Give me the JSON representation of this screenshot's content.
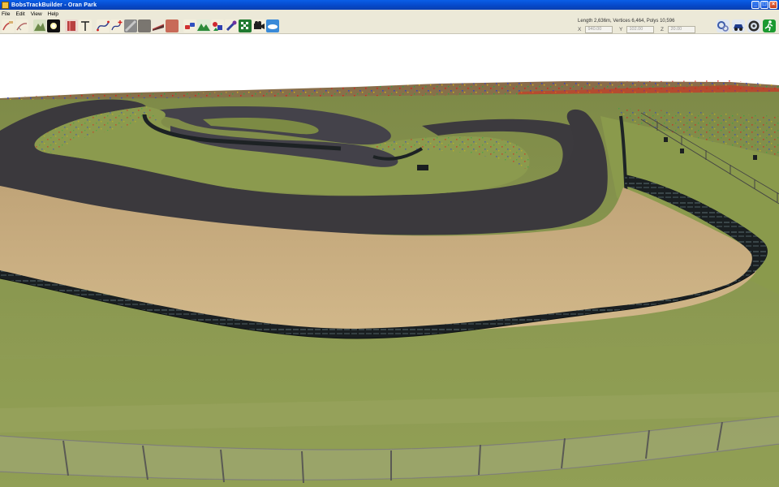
{
  "window": {
    "title": "BobsTrackBuilder - Oran Park",
    "buttons": {
      "minimize": "_",
      "maximize": "□",
      "close": "×"
    }
  },
  "menu": [
    "File",
    "Edit",
    "View",
    "Help"
  ],
  "toolbar": {
    "tool_icons": [
      "pencil-curve-icon",
      "select-curve-icon",
      "terrain-icon",
      "camera-flash-icon",
      "wall-red-icon",
      "fence-post-icon",
      "road-sign-icon",
      "spline-icon",
      "spline-add-icon",
      "object-icon",
      "texture-grey-icon",
      "road-slope-icon",
      "texture-red-icon",
      "object-cars-icon",
      "mountains-icon",
      "objects-palette-icon",
      "brush-icon",
      "checker-flag-icon",
      "video-camera-icon",
      "sky-icon"
    ],
    "stats": "Length 2,636m, Vertices 6,464, Polys 10,596",
    "coords": {
      "x_label": "X",
      "x_value": "940.00",
      "y_label": "Y",
      "y_value": "102.00",
      "z_label": "Z",
      "z_value": "20.00"
    },
    "right_icons": [
      "settings-gears-icon",
      "spy-car-icon",
      "steering-wheel-icon",
      "run-icon"
    ]
  },
  "colors": {
    "titlebar": "#0648c8",
    "chrome": "#ece9d8",
    "grass": "#8a9a48",
    "asphalt": "#3d3b3f",
    "sand": "#c8ad80",
    "tyre": "#1e2426"
  }
}
